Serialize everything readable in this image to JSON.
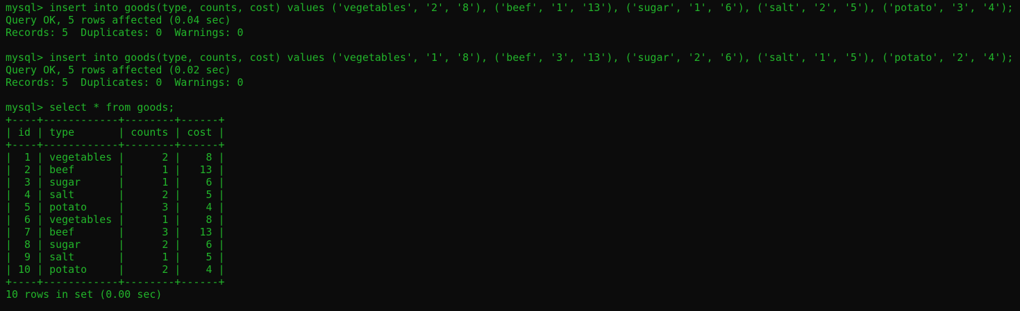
{
  "colors": {
    "background": "#0c0c0c",
    "text": "#22b52a"
  },
  "terminal": {
    "lines": [
      "mysql> insert into goods(type, counts, cost) values ('vegetables', '2', '8'), ('beef', '1', '13'), ('sugar', '1', '6'), ('salt', '2', '5'), ('potato', '3', '4');",
      "Query OK, 5 rows affected (0.04 sec)",
      "Records: 5  Duplicates: 0  Warnings: 0",
      "",
      "mysql> insert into goods(type, counts, cost) values ('vegetables', '1', '8'), ('beef', '3', '13'), ('sugar', '2', '6'), ('salt', '1', '5'), ('potato', '2', '4');",
      "Query OK, 5 rows affected (0.02 sec)",
      "Records: 5  Duplicates: 0  Warnings: 0",
      "",
      "mysql> select * from goods;",
      "+----+------------+--------+------+",
      "| id | type       | counts | cost |",
      "+----+------------+--------+------+",
      "|  1 | vegetables |      2 |    8 |",
      "|  2 | beef       |      1 |   13 |",
      "|  3 | sugar      |      1 |    6 |",
      "|  4 | salt       |      2 |    5 |",
      "|  5 | potato     |      3 |    4 |",
      "|  6 | vegetables |      1 |    8 |",
      "|  7 | beef       |      3 |   13 |",
      "|  8 | sugar      |      2 |    6 |",
      "|  9 | salt       |      1 |    5 |",
      "| 10 | potato     |      2 |    4 |",
      "+----+------------+--------+------+",
      "10 rows in set (0.00 sec)"
    ]
  }
}
